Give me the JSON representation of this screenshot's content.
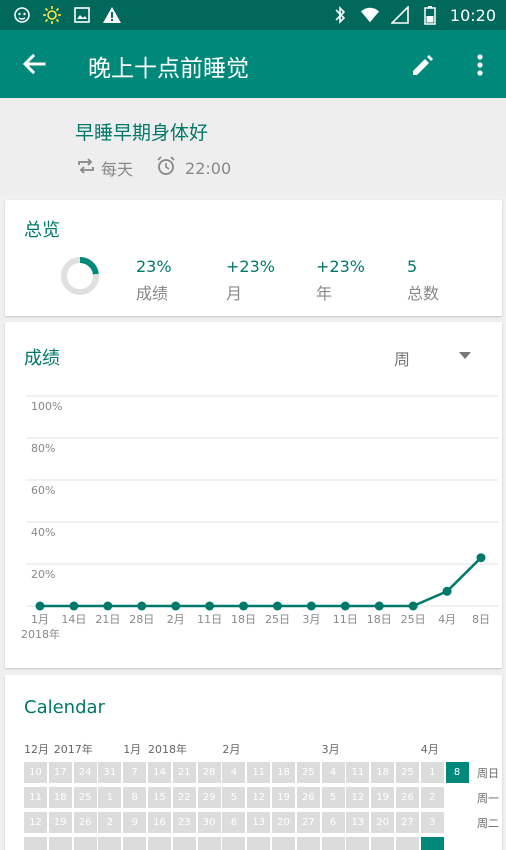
{
  "status_bar": {
    "time": "10:20",
    "left_icons": [
      "nfc-face-icon",
      "sun-icon",
      "image-icon",
      "warning-icon"
    ],
    "right_icons": [
      "bluetooth-icon",
      "wifi-icon",
      "signal-icon",
      "battery-icon"
    ]
  },
  "app_bar": {
    "title": "晚上十点前睡觉",
    "icons": [
      "back-arrow-icon",
      "edit-pencil-icon",
      "more-vert-icon"
    ]
  },
  "header": {
    "subtitle": "早睡早期身体好",
    "repeat": "每天",
    "reminder": "22:00"
  },
  "overview": {
    "title": "总览",
    "ring_fraction": 0.23,
    "stats": [
      {
        "value": "23%",
        "label": "成绩"
      },
      {
        "value": "+23%",
        "label": "月"
      },
      {
        "value": "+23%",
        "label": "年"
      },
      {
        "value": "5",
        "label": "总数"
      }
    ]
  },
  "score": {
    "title": "成绩",
    "period": "周"
  },
  "chart_data": {
    "type": "line",
    "ylim": [
      0,
      100
    ],
    "y_ticks": [
      "100%",
      "80%",
      "60%",
      "40%",
      "20%"
    ],
    "categories": [
      "1月",
      "14日",
      "21日",
      "28日",
      "2月",
      "11日",
      "18日",
      "25日",
      "3月",
      "11日",
      "18日",
      "25日",
      "4月",
      "8日"
    ],
    "x_extra_label": "2018年",
    "series": [
      {
        "values": [
          0,
          0,
          0,
          0,
          0,
          0,
          0,
          0,
          0,
          0,
          0,
          0,
          7,
          23
        ]
      }
    ],
    "grid": true,
    "color": "#00796b"
  },
  "calendar": {
    "title": "Calendar",
    "month_labels": [
      "12月",
      "2017年",
      "1月",
      "2018年",
      "2月",
      "3月",
      "4月"
    ],
    "row_labels": [
      "周日",
      "周一",
      "周二"
    ],
    "rows": [
      [
        "10",
        "17",
        "24",
        "31",
        "7",
        "14",
        "21",
        "28",
        "4",
        "11",
        "18",
        "25",
        "4",
        "11",
        "18",
        "25",
        "1",
        "8"
      ],
      [
        "11",
        "18",
        "25",
        "1",
        "8",
        "15",
        "22",
        "29",
        "5",
        "12",
        "19",
        "26",
        "5",
        "12",
        "19",
        "26",
        "2",
        ""
      ],
      [
        "12",
        "19",
        "26",
        "2",
        "9",
        "16",
        "23",
        "30",
        "6",
        "13",
        "20",
        "27",
        "6",
        "13",
        "20",
        "27",
        "3",
        ""
      ]
    ],
    "highlight_color": "#00897b"
  }
}
